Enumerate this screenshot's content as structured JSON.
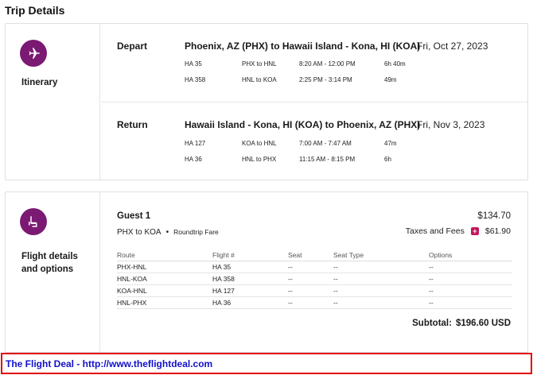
{
  "page": {
    "title": "Trip Details"
  },
  "itinerary": {
    "label": "Itinerary",
    "legs": [
      {
        "type": "Depart",
        "route": "Phoenix, AZ (PHX) to Hawaii Island - Kona, HI (KOA)",
        "date": "Fri, Oct 27, 2023",
        "segments": [
          {
            "flight": "HA 35",
            "route": "PHX to HNL",
            "time": "8:20 AM - 12:00 PM",
            "duration": "6h 40m"
          },
          {
            "flight": "HA 358",
            "route": "HNL to KOA",
            "time": "2:25 PM - 3:14 PM",
            "duration": "49m"
          }
        ]
      },
      {
        "type": "Return",
        "route": "Hawaii Island - Kona, HI (KOA) to Phoenix, AZ (PHX)",
        "date": "Fri, Nov 3, 2023",
        "segments": [
          {
            "flight": "HA 127",
            "route": "KOA to HNL",
            "time": "7:00 AM - 7:47 AM",
            "duration": "47m"
          },
          {
            "flight": "HA 36",
            "route": "HNL to PHX",
            "time": "11:15 AM - 8:15 PM",
            "duration": "6h"
          }
        ]
      }
    ]
  },
  "flight_details": {
    "label": "Flight details and options",
    "guest": {
      "name": "Guest 1",
      "total": "$134.70",
      "route": "PHX to KOA",
      "separator": "•",
      "fare": "Roundtrip Fare",
      "taxes_label": "Taxes and Fees",
      "taxes_amount": "$61.90",
      "plus_symbol": "+"
    },
    "table": {
      "headers": [
        "Route",
        "Flight #",
        "Seat",
        "Seat Type",
        "Options"
      ],
      "rows": [
        [
          "PHX-HNL",
          "HA 35",
          "--",
          "--",
          "--"
        ],
        [
          "HNL-KOA",
          "HA 358",
          "--",
          "--",
          "--"
        ],
        [
          "KOA-HNL",
          "HA 127",
          "--",
          "--",
          "--"
        ],
        [
          "HNL-PHX",
          "HA 36",
          "--",
          "--",
          "--"
        ]
      ]
    },
    "subtotal_label": "Subtotal:",
    "subtotal_amount": "$196.60 USD"
  },
  "banner": {
    "text": "The Flight Deal - http://www.theflightdeal.com"
  },
  "colors": {
    "accent": "#7b1a73",
    "plus": "#c2185b",
    "banner_border": "#e00000",
    "banner_text": "#1111cc"
  },
  "icons": {
    "itinerary": "airplane-icon",
    "flight_details": "airline-seat-icon",
    "taxes": "plus-icon"
  }
}
